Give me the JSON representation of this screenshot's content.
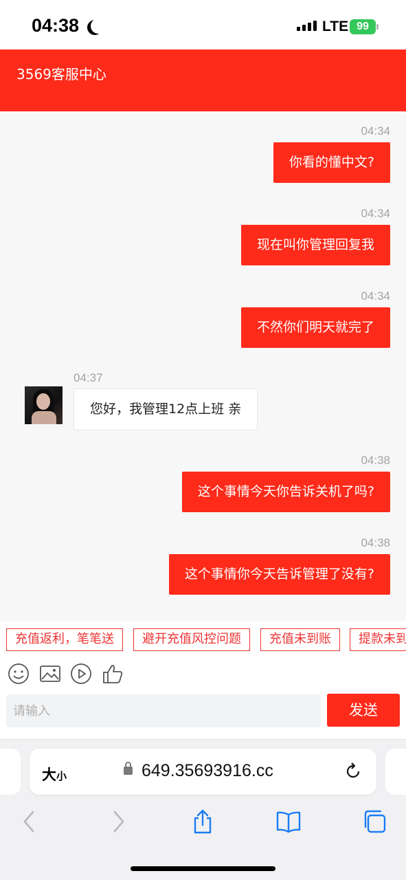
{
  "status_bar": {
    "time": "04:38",
    "network": "LTE",
    "battery": "99"
  },
  "header": {
    "title": "3569客服中心"
  },
  "messages": [
    {
      "time": "04:34",
      "text": "你看的懂中文?",
      "direction": "out"
    },
    {
      "time": "04:34",
      "text": "现在叫你管理回复我",
      "direction": "out"
    },
    {
      "time": "04:34",
      "text": "不然你们明天就完了",
      "direction": "out"
    },
    {
      "time": "04:37",
      "text": "您好，我管理12点上班 亲",
      "direction": "in"
    },
    {
      "time": "04:38",
      "text": "这个事情今天你告诉关机了吗?",
      "direction": "out"
    },
    {
      "time": "04:38",
      "text": "这个事情你今天告诉管理了没有?",
      "direction": "out"
    }
  ],
  "quick_replies": [
    "充值返利，笔笔送",
    "避开充值风控问题",
    "充值未到账",
    "提款未到"
  ],
  "tools": [
    "emoji-icon",
    "image-icon",
    "video-icon",
    "thumbs-up-icon"
  ],
  "input": {
    "placeholder": "请输入",
    "send_label": "发送"
  },
  "browser": {
    "text_size_label": "大",
    "text_size_small": "小",
    "url": "649.35693916.cc"
  },
  "colors": {
    "brand": "#fe2a1a",
    "battery": "#34c759",
    "safari_blue": "#1a7cf5"
  }
}
